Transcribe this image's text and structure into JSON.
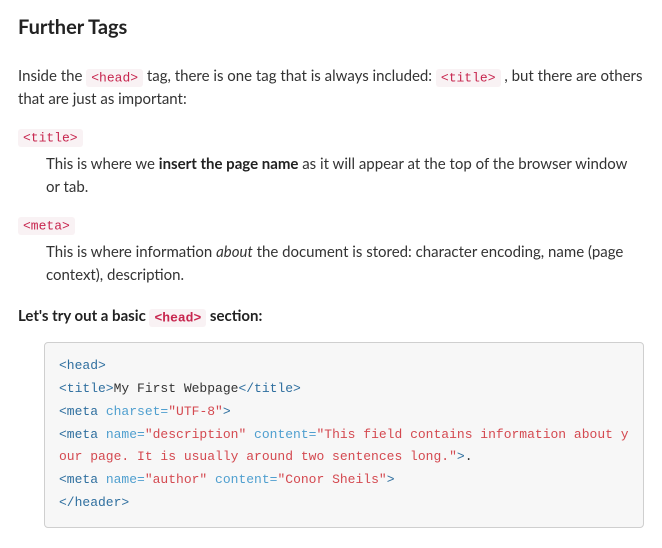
{
  "heading": "Further Tags",
  "intro": {
    "p1a": "Inside the ",
    "code1": "<head>",
    "p1b": " tag, there is one tag that is always included: ",
    "code2": "<title>",
    "p1c": " , but there are others that are just as important:"
  },
  "defs": {
    "title_term": "<title>",
    "title_def_a": "This is where we ",
    "title_def_b": "insert the page name",
    "title_def_c": " as it will appear at the top of the browser window or tab.",
    "meta_term": "<meta>",
    "meta_def_a": "This is where information ",
    "meta_def_b": "about",
    "meta_def_c": " the document is stored: character encoding, name (page context), description."
  },
  "lead": {
    "a": "Let's try out a basic ",
    "code": "<head>",
    "b": " section:"
  },
  "code": {
    "l1_tag": "<head>",
    "l2_open": "<title>",
    "l2_text": "My First Webpage",
    "l2_close": "</title>",
    "l3_tag_open": "<meta",
    "l3_attr": " charset=",
    "l3_val": "\"UTF-8\"",
    "l3_tag_close": ">",
    "l4_tag_open": "<meta",
    "l4_attr1": " name=",
    "l4_val1": "\"description\"",
    "l4_attr2": " content=",
    "l4_val2": "\"This field contains information about your page. It is usually around two sentences long.\"",
    "l4_tag_close": ">",
    "l4_trail": ".",
    "l5_tag_open": "<meta",
    "l5_attr1": " name=",
    "l5_val1": "\"author\"",
    "l5_attr2": " content=",
    "l5_val2": "\"Conor Sheils\"",
    "l5_tag_close": ">",
    "l6_tag": "</header>"
  }
}
